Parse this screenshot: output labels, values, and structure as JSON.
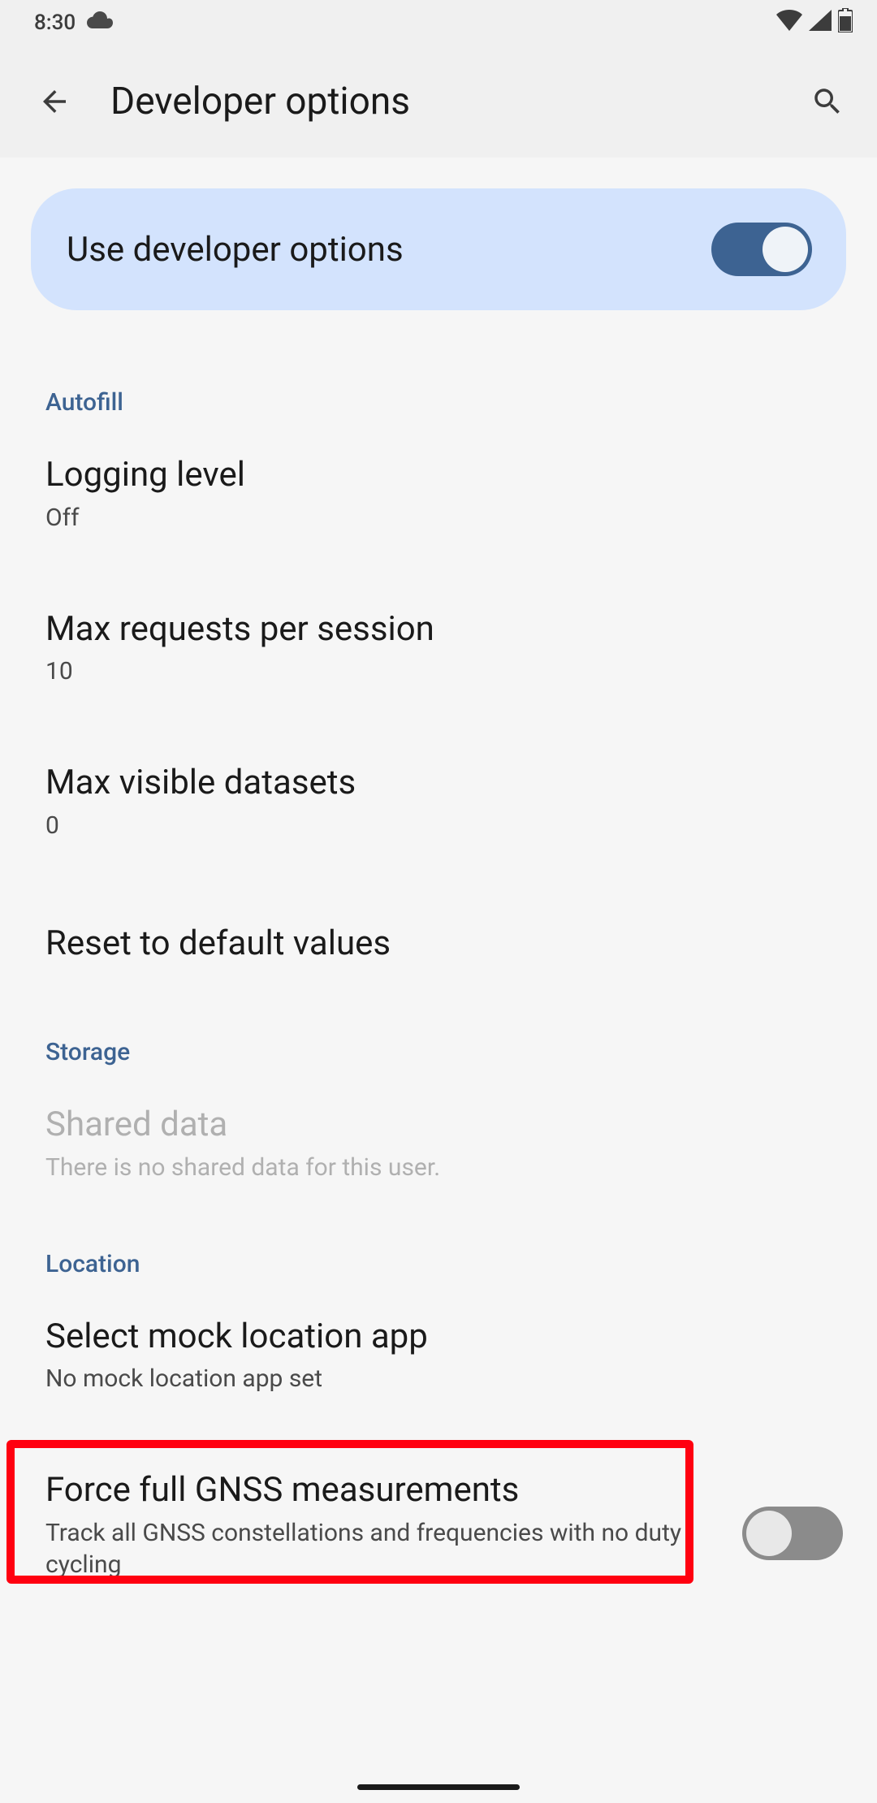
{
  "statusBar": {
    "time": "8:30"
  },
  "appBar": {
    "title": "Developer options"
  },
  "masterToggle": {
    "label": "Use developer options",
    "enabled": true
  },
  "sections": {
    "autofill": {
      "header": "Autofill",
      "items": {
        "loggingLevel": {
          "title": "Logging level",
          "subtitle": "Off"
        },
        "maxRequests": {
          "title": "Max requests per session",
          "subtitle": "10"
        },
        "maxDatasets": {
          "title": "Max visible datasets",
          "subtitle": "0"
        },
        "reset": {
          "title": "Reset to default values"
        }
      }
    },
    "storage": {
      "header": "Storage",
      "items": {
        "sharedData": {
          "title": "Shared data",
          "subtitle": "There is no shared data for this user."
        }
      }
    },
    "location": {
      "header": "Location",
      "items": {
        "mockLocation": {
          "title": "Select mock location app",
          "subtitle": "No mock location app set"
        },
        "gnss": {
          "title": "Force full GNSS measurements",
          "subtitle": "Track all GNSS constellations and frequencies with no duty cycling",
          "enabled": false
        }
      }
    }
  }
}
